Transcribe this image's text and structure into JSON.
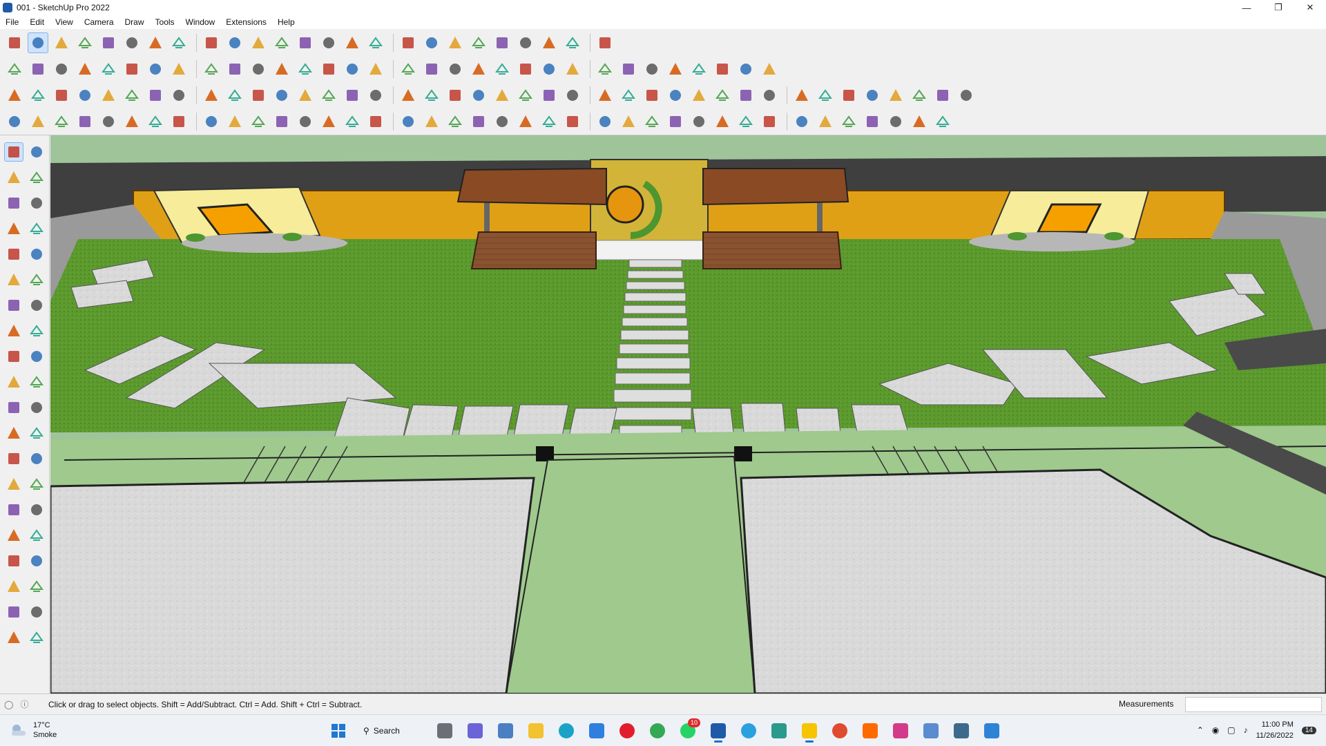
{
  "window": {
    "title": "001 - SketchUp Pro 2022",
    "controls": [
      "minimize-icon",
      "maximize-icon",
      "close-icon"
    ]
  },
  "menu": [
    "File",
    "Edit",
    "View",
    "Camera",
    "Draw",
    "Tools",
    "Window",
    "Extensions",
    "Help"
  ],
  "toolbar_rows": [
    [
      "search-icon",
      "select-arrow-icon",
      "eraser-icon",
      "pencil-icon",
      "lasso-icon",
      "rectangle-icon",
      "push-pull-icon",
      "follow-me-icon",
      "move-icon",
      "rotate-icon",
      "scale-icon",
      "tape-measure-icon",
      "text-icon",
      "paint-bucket-icon",
      "orbit-icon",
      "pan-icon",
      "zoom-icon",
      "zoom-extents-icon",
      "warehouse-icon",
      "extension-icon",
      "layers-icon",
      "styles-icon",
      "profile-icon",
      "sandbox-icon",
      "section-icon"
    ],
    [
      "camera-icon",
      "iso-view-icon",
      "top-view-icon",
      "front-view-icon",
      "right-view-icon",
      "back-view-icon",
      "left-view-icon",
      "bottom-view-icon",
      "xray-icon",
      "wireframe-icon",
      "hidden-line-icon",
      "shaded-icon",
      "textured-icon",
      "monochrome-icon",
      "section-plane-icon",
      "section-cut-icon",
      "section-fill-icon",
      "solid-union-icon",
      "solid-subtract-icon",
      "solid-trim-icon",
      "solid-intersect-icon",
      "solid-split-icon",
      "outer-shell-icon",
      "sandbox-smoove-icon",
      "sandbox-stamp-icon",
      "sandbox-drape-icon",
      "sandbox-flip-icon",
      "axes-icon",
      "guide-icon",
      "north-arrow-icon",
      "shadow-icon",
      "fog-icon"
    ],
    [
      "component-icon",
      "group-icon",
      "measure-icon",
      "dimension-icon",
      "protractor-icon",
      "axis-icon",
      "3d-text-icon",
      "entity-info-icon",
      "outliner-icon",
      "materials-icon",
      "scene-icon",
      "soften-icon",
      "hide-icon",
      "unhide-icon",
      "lock-icon",
      "unlock-icon",
      "explode-icon",
      "intersect-icon",
      "weld-icon",
      "curve-icon",
      "arc-icon",
      "polygon-icon",
      "circle-icon",
      "offset-icon",
      "bezier-icon",
      "spline-icon",
      "extrude-icon",
      "loft-icon",
      "sweep-icon",
      "shell-icon",
      "roundcorner-icon",
      "chamfer-icon",
      "fillet-icon",
      "subdivide-icon",
      "smooth-icon",
      "crease-icon",
      "joint-icon",
      "vertex-icon",
      "edge-icon",
      "face-icon"
    ],
    [
      "layer-blue-icon",
      "layer-blue2-icon",
      "layer-yellow-icon",
      "layer-green-icon",
      "layer-red-icon",
      "layer-glass-icon",
      "arc-tool-icon",
      "red-square-icon",
      "frame-icon",
      "page-icon",
      "box-icon",
      "pipe-icon",
      "stair-icon",
      "path-icon",
      "add-icon",
      "cross-icon",
      "star-icon",
      "cone-icon",
      "pyramid-icon",
      "warning-icon",
      "loop-icon",
      "spiral-icon",
      "coil-icon",
      "move-vertex-icon",
      "crate-icon",
      "undo-curve-icon",
      "puzzle-icon",
      "gear-icon",
      "plugin-a-icon",
      "plugin-b-icon",
      "plugin-c-icon",
      "plugin-d-icon",
      "plugin-e-icon",
      "grid-a-icon",
      "grid-b-icon",
      "grid-c-icon",
      "scatter-icon",
      "circle-dots-icon",
      "export-icon"
    ]
  ],
  "left_tools": [
    "select-icon",
    "orbit-lasso-icon",
    "paint-icon",
    "eraser-icon",
    "component-icon",
    "pencil-icon",
    "line-icon",
    "freehand-icon",
    "rectangle-icon",
    "rotated-rectangle-icon",
    "circle-icon",
    "polygon-icon",
    "arc-icon",
    "pie-icon",
    "move-icon",
    "push-pull-icon",
    "rotate-icon",
    "follow-me-icon",
    "scale-icon",
    "offset-icon",
    "tape-icon",
    "dimension-icon",
    "protractor-icon",
    "text-icon",
    "axes-icon",
    "3d-text-icon",
    "orbit-icon",
    "pan-icon",
    "zoom-icon",
    "zoom-window-icon",
    "zoom-extents-icon",
    "previous-icon",
    "walk-icon",
    "look-around-icon",
    "footprints-icon",
    "section-icon",
    "warehouse-icon",
    "extension-icon",
    "layers-icon",
    "styles-icon"
  ],
  "status": {
    "message": "Click or drag to select objects. Shift = Add/Subtract. Ctrl = Add. Shift + Ctrl = Subtract.",
    "measurements_label": "Measurements",
    "measurements_value": ""
  },
  "taskbar": {
    "weather_temp": "17°C",
    "weather_desc": "Smoke",
    "search_label": "Search",
    "apps": [
      "start-icon",
      "search-icon",
      "task-view-icon",
      "chat-icon",
      "calculator-icon",
      "file-explorer-icon",
      "edge-icon",
      "store-icon",
      "opera-icon",
      "chrome-icon",
      "whatsapp-icon",
      "sketchup-icon",
      "telegram-icon",
      "teams-icon",
      "sticky-notes-icon",
      "grammarly-icon",
      "soundcloud-icon",
      "instagram-icon",
      "photos-icon",
      "code-icon",
      "outlook-icon"
    ],
    "whatsapp_badge": "10",
    "time": "11:00 PM",
    "date": "11/26/2022",
    "notification_count": "14"
  }
}
